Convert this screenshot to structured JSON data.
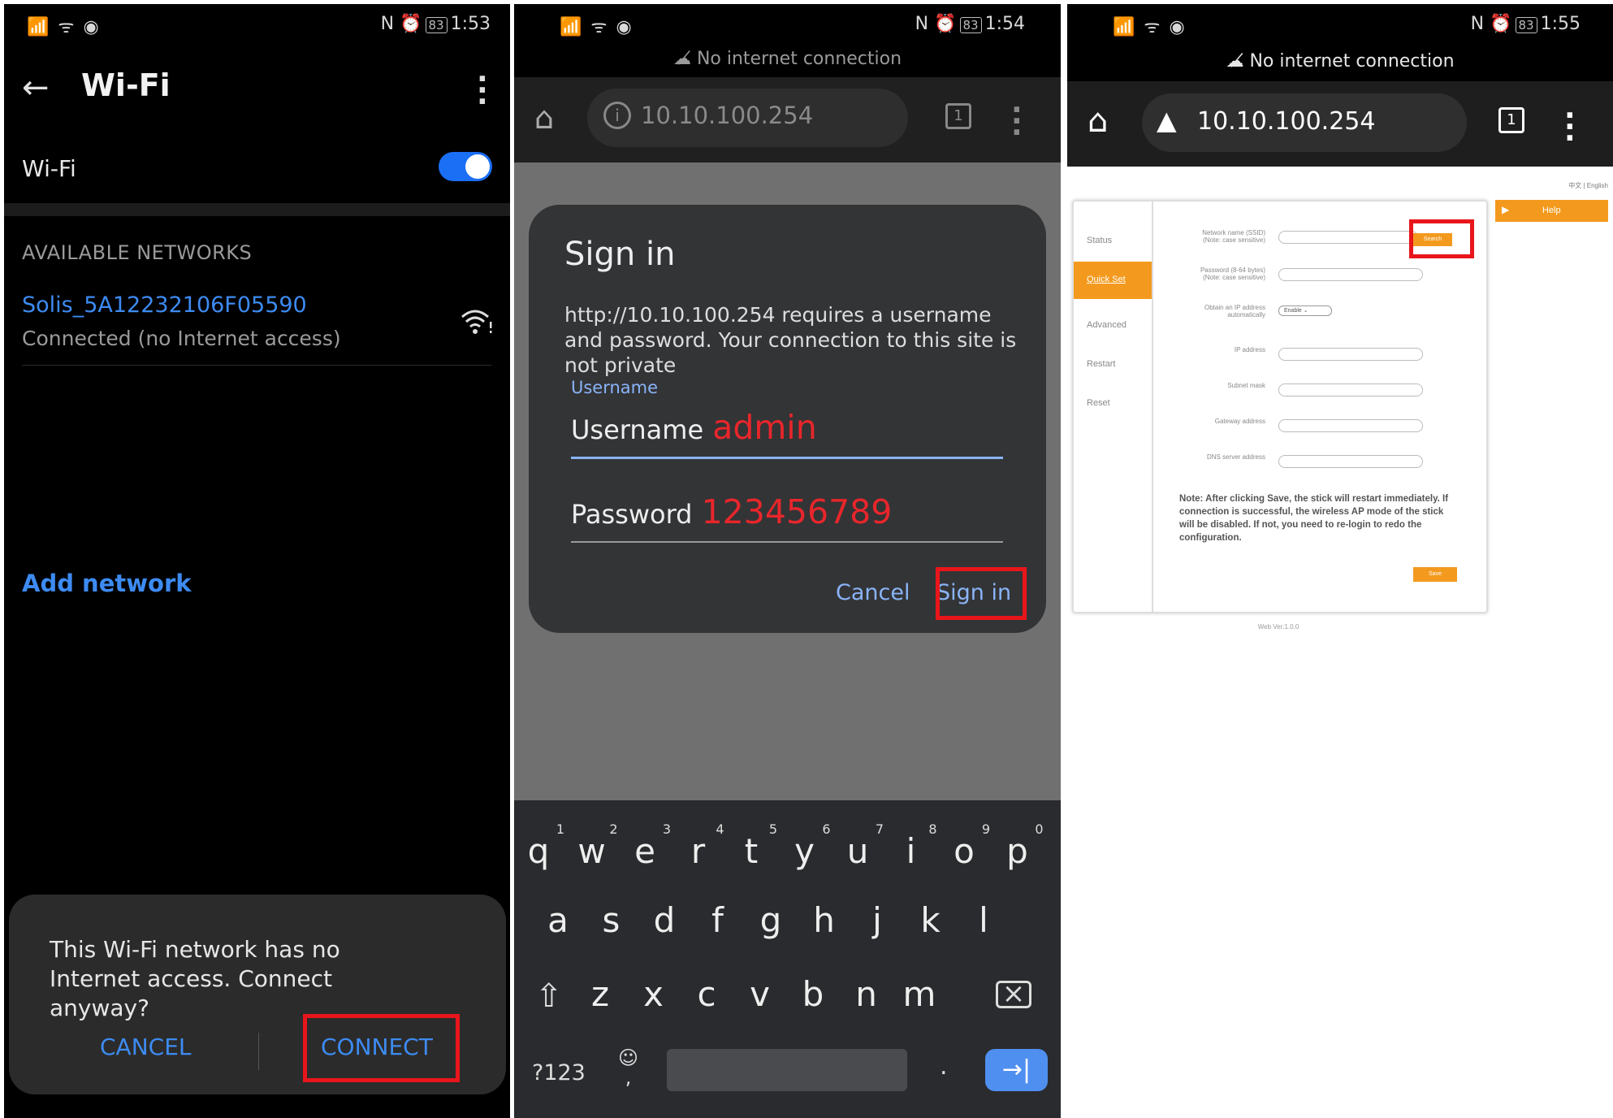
{
  "panel1": {
    "status": {
      "signal": "📶 ᯤ ◉",
      "nfc": "N",
      "alarm": "⏰",
      "battery": "83",
      "time": "1:53"
    },
    "title": "Wi-Fi",
    "wifi_label": "Wi-Fi",
    "toggle_on": true,
    "section_header": "AVAILABLE NETWORKS",
    "network": {
      "ssid": "Solis_5A12232106F05590",
      "status": "Connected (no Internet access)"
    },
    "add_network": "Add network",
    "dialog": {
      "message": "This Wi-Fi network has no Internet access. Connect anyway?",
      "cancel": "CANCEL",
      "connect": "CONNECT"
    }
  },
  "panel2": {
    "status": {
      "battery": "83",
      "time": "1:54"
    },
    "no_internet": "No internet connection",
    "url": "10.10.100.254",
    "tab_count": "1",
    "dialog": {
      "title": "Sign in",
      "message": "http://10.10.100.254 requires a username and password. Your connection to this site is not private",
      "username_floating": "Username",
      "username_label": "Username",
      "username_value": "admin",
      "password_label": "Password",
      "password_value": "123456789",
      "cancel": "Cancel",
      "sign_in": "Sign in"
    },
    "keyboard": {
      "row1": [
        [
          "q",
          "1"
        ],
        [
          "w",
          "2"
        ],
        [
          "e",
          "3"
        ],
        [
          "r",
          "4"
        ],
        [
          "t",
          "5"
        ],
        [
          "y",
          "6"
        ],
        [
          "u",
          "7"
        ],
        [
          "i",
          "8"
        ],
        [
          "o",
          "9"
        ],
        [
          "p",
          "0"
        ]
      ],
      "row2": [
        "a",
        "s",
        "d",
        "f",
        "g",
        "h",
        "j",
        "k",
        "l"
      ],
      "row3": [
        "z",
        "x",
        "c",
        "v",
        "b",
        "n",
        "m"
      ],
      "sym": "?123",
      "emoji": "☺",
      "comma": ",",
      "period": ".",
      "enter": "→|"
    }
  },
  "panel3": {
    "status": {
      "battery": "83",
      "time": "1:55"
    },
    "no_internet": "No internet connection",
    "url": "10.10.100.254",
    "tab_count": "1",
    "web": {
      "lang": "中文 | English",
      "help": "Help",
      "nav": [
        "Status",
        "Quick Set",
        "Advanced",
        "Restart",
        "Reset"
      ],
      "fields": [
        {
          "label": "Network name (SSID)\n(Note: case sensitive)"
        },
        {
          "label": "Password (8-64 bytes)\n(Note: case sensitive)"
        },
        {
          "label": "Obtain an IP address\nautomatically"
        },
        {
          "label": "IP address"
        },
        {
          "label": "Subnet mask"
        },
        {
          "label": "Gateway address"
        },
        {
          "label": "DNS server address"
        }
      ],
      "search": "Search",
      "enable": "Enable",
      "note": "Note: After clicking Save, the stick will restart immediately. If connection is successful, the wireless AP mode of the stick will be disabled. If not, you need to re-login to redo the configuration.",
      "save": "Save",
      "version": "Web Ver:1.0.0"
    }
  },
  "colors": {
    "accent_blue": "#3d8bf2",
    "highlight_red": "#e8161b",
    "orange": "#f39a1e",
    "annotation_red": "#e8262b"
  }
}
